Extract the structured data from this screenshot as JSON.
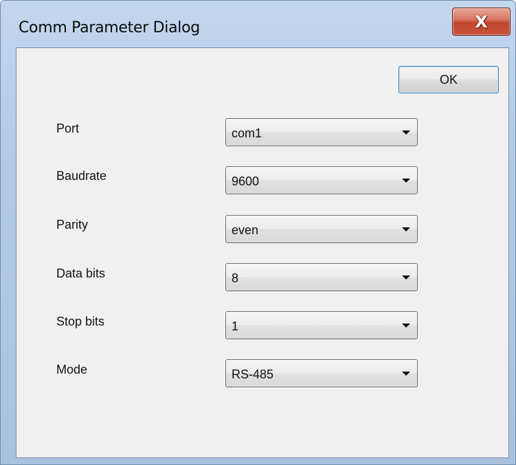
{
  "window": {
    "title": "Comm Parameter Dialog",
    "close_glyph": "X"
  },
  "buttons": {
    "ok_label": "OK"
  },
  "fields": [
    {
      "label": "Port",
      "value": "com1"
    },
    {
      "label": "Baudrate",
      "value": "9600"
    },
    {
      "label": "Parity",
      "value": "even"
    },
    {
      "label": "Data bits",
      "value": "8"
    },
    {
      "label": "Stop bits",
      "value": "1"
    },
    {
      "label": "Mode",
      "value": "RS-485"
    }
  ],
  "icons": {
    "close": "close-icon",
    "dropdown": "chevron-down-icon"
  },
  "colors": {
    "client_background": "#f0f0f0",
    "close_button": "#c7452c",
    "ok_button_border": "#3c7fb1"
  }
}
